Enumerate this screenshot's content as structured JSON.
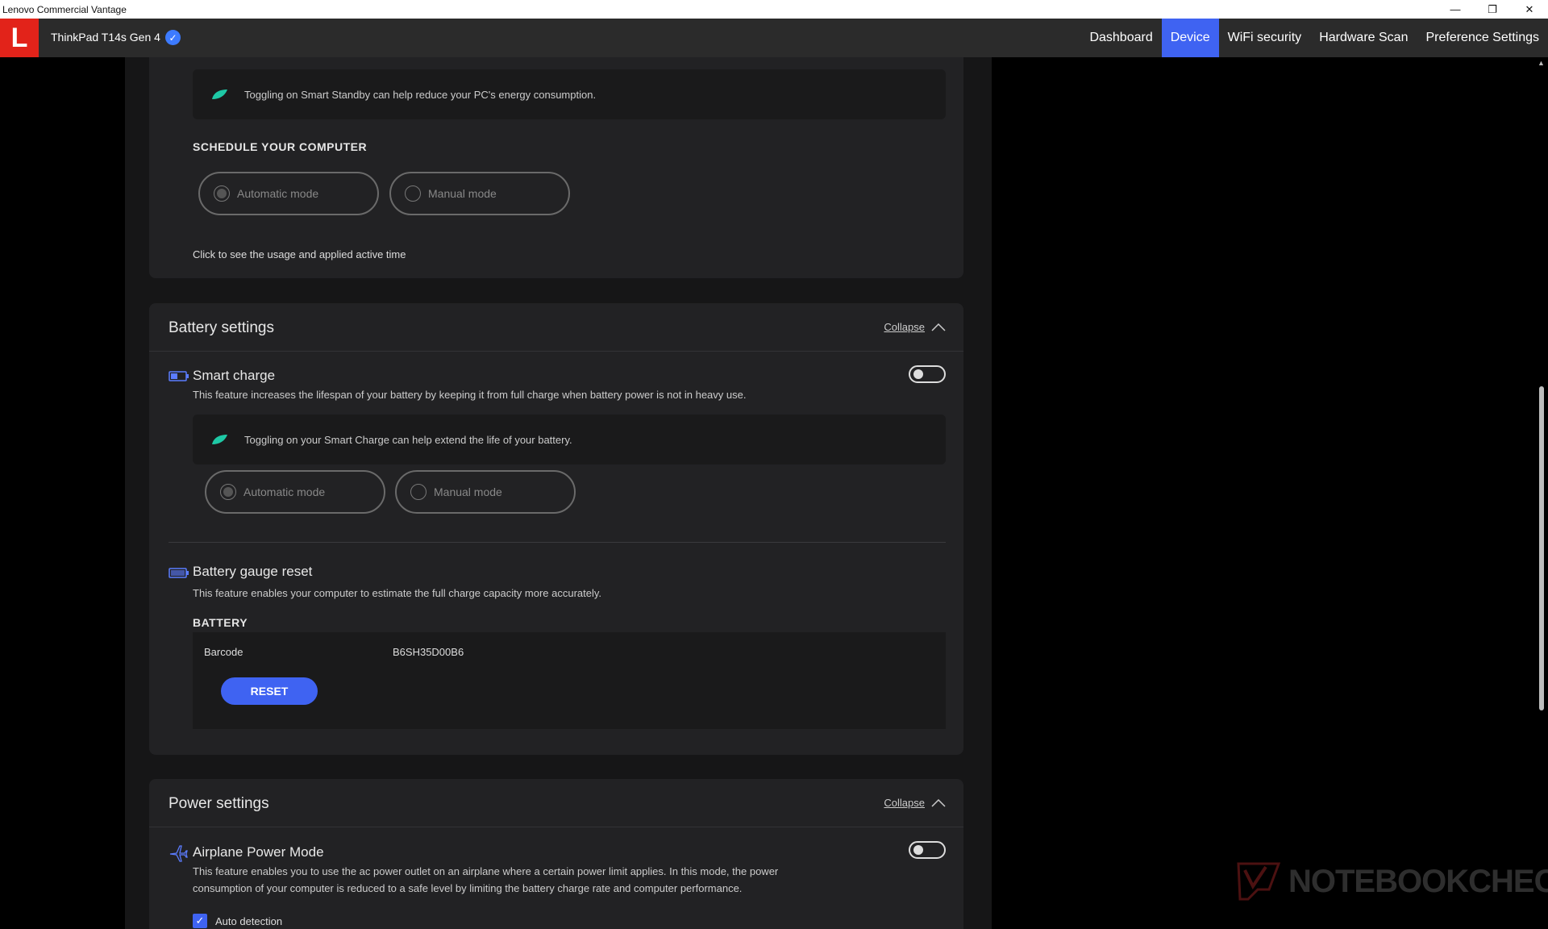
{
  "window": {
    "title": "Lenovo Commercial Vantage"
  },
  "header": {
    "logo_letter": "L",
    "device_name": "ThinkPad T14s Gen 4",
    "nav_tabs": [
      {
        "label": "Dashboard",
        "active": false
      },
      {
        "label": "Device",
        "active": true
      },
      {
        "label": "WiFi security",
        "active": false
      },
      {
        "label": "Hardware Scan",
        "active": false
      },
      {
        "label": "Preference Settings",
        "active": false
      }
    ],
    "accent_color": "#3f63f2",
    "logo_color": "#e2231a"
  },
  "smart_standby": {
    "info_text": "Toggling on Smart Standby can help reduce your PC's energy consumption.",
    "schedule_heading": "SCHEDULE YOUR COMPUTER",
    "modes": [
      {
        "label": "Automatic mode",
        "selected": true
      },
      {
        "label": "Manual mode",
        "selected": false
      }
    ],
    "usage_link": "Click to see the usage and applied active time"
  },
  "battery_settings": {
    "title": "Battery settings",
    "collapse_label": "Collapse",
    "smart_charge": {
      "title": "Smart charge",
      "description": "This feature increases the lifespan of your battery by keeping it from full charge when battery power is not in heavy use.",
      "enabled": false,
      "info_text": "Toggling on your Smart Charge can help extend the life of your battery.",
      "modes": [
        {
          "label": "Automatic mode",
          "selected": true
        },
        {
          "label": "Manual mode",
          "selected": false
        }
      ]
    },
    "gauge_reset": {
      "title": "Battery gauge reset",
      "description": "This feature enables your computer to estimate the full charge capacity more accurately.",
      "battery_heading": "BATTERY",
      "barcode_label": "Barcode",
      "barcode_value": "B6SH35D00B6",
      "reset_label": "RESET"
    }
  },
  "power_settings": {
    "title": "Power settings",
    "collapse_label": "Collapse",
    "airplane_mode": {
      "title": "Airplane Power Mode",
      "description_line1": "This feature enables you to use the ac power outlet on an airplane where a certain power limit applies. In this mode, the power",
      "description_line2": "consumption of your computer is reduced to a safe level by limiting the battery charge rate and computer performance.",
      "enabled": false,
      "auto_detection_label": "Auto detection",
      "auto_detection_checked": true
    }
  },
  "watermark": {
    "text": "NOTEBOOKCHECK"
  }
}
